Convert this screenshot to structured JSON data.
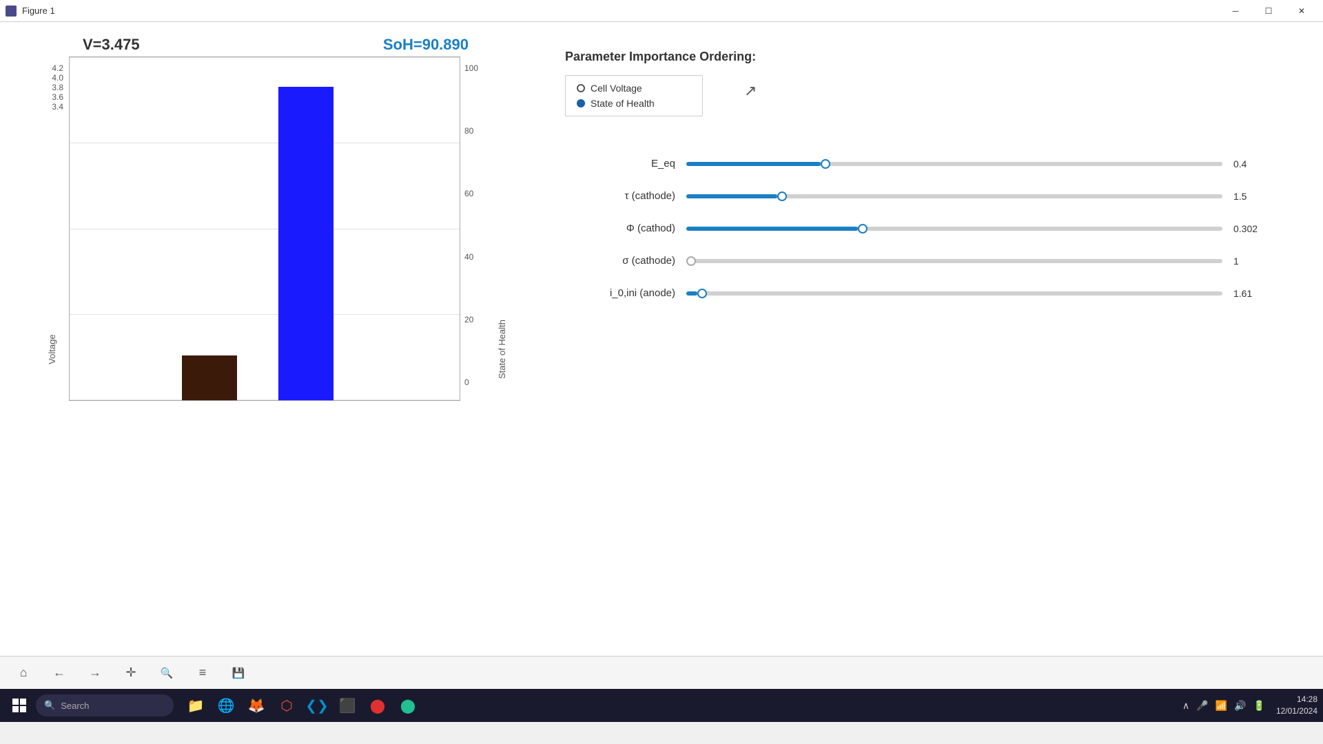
{
  "window": {
    "title": "Figure 1",
    "controls": {
      "minimize": "─",
      "maximize": "☐",
      "close": "✕"
    }
  },
  "chart": {
    "v_label": "V=3.475",
    "soh_label": "SoH=90.890",
    "y_axis_left_label": "Voltage",
    "y_axis_right_label": "State of Health",
    "y_left_ticks": [
      "4.2",
      "4.0",
      "3.8",
      "3.6",
      "3.4"
    ],
    "y_right_ticks": [
      "100",
      "80",
      "60",
      "40",
      "20",
      "0"
    ],
    "bar_dark_height_pct": 13,
    "bar_blue_height_pct": 91
  },
  "right_panel": {
    "title": "Parameter Importance Ordering:",
    "legend": {
      "items": [
        {
          "label": "Cell Voltage",
          "type": "outline"
        },
        {
          "label": "State of Health",
          "type": "filled"
        }
      ]
    },
    "sliders": [
      {
        "label": "E_eq",
        "fill_pct": 25,
        "thumb_pct": 25,
        "value": "0.4"
      },
      {
        "label": "τ (cathode)",
        "fill_pct": 17,
        "thumb_pct": 17,
        "value": "1.5"
      },
      {
        "label": "Φ (cathod)",
        "fill_pct": 32,
        "thumb_pct": 32,
        "value": "0.302"
      },
      {
        "label": "σ (cathode)",
        "fill_pct": 0,
        "thumb_pct": 0,
        "value": "1"
      },
      {
        "label": "i_0,ini (anode)",
        "fill_pct": 2,
        "thumb_pct": 2,
        "value": "1.61"
      }
    ]
  },
  "toolbar": {
    "buttons": [
      {
        "name": "home",
        "icon": "⌂"
      },
      {
        "name": "back",
        "icon": "←"
      },
      {
        "name": "forward",
        "icon": "→"
      },
      {
        "name": "move",
        "icon": "✛"
      },
      {
        "name": "zoom",
        "icon": "🔍"
      },
      {
        "name": "configure",
        "icon": "≡"
      },
      {
        "name": "save",
        "icon": "💾"
      }
    ]
  },
  "taskbar": {
    "search_placeholder": "Search",
    "time": "14:28",
    "date": "12/01/2024",
    "apps": [
      {
        "name": "file-explorer",
        "icon": "📁"
      },
      {
        "name": "chrome",
        "icon": "🌐"
      },
      {
        "name": "firefox",
        "icon": "🦊"
      },
      {
        "name": "git",
        "icon": "🔴"
      },
      {
        "name": "vscode",
        "icon": "💙"
      },
      {
        "name": "terminal",
        "icon": "⬛"
      },
      {
        "name": "app6",
        "icon": "🔴"
      },
      {
        "name": "app7",
        "icon": "🟢"
      }
    ]
  }
}
